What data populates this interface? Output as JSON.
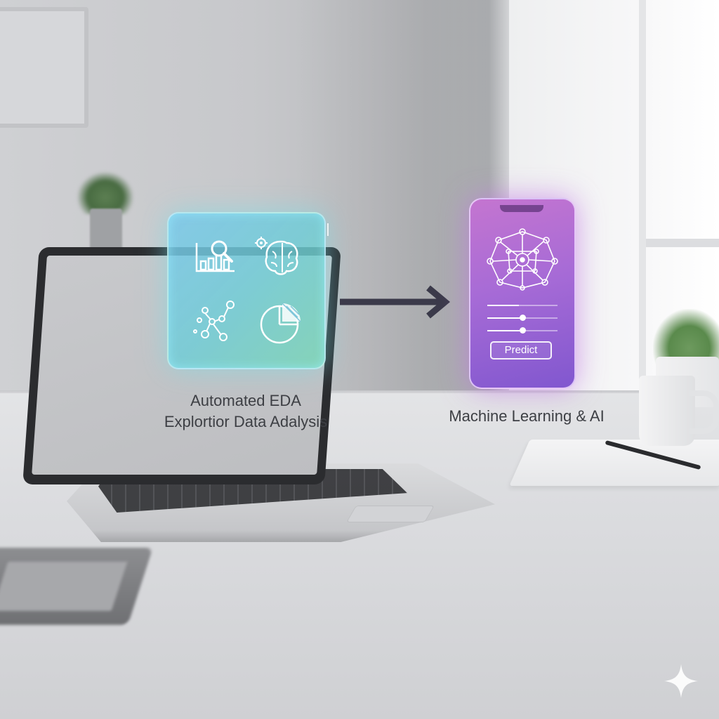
{
  "eda": {
    "title": "Automated EDA",
    "subtitle": "Explortior Data Adalysis",
    "icons": [
      "bar-chart-magnifier-icon",
      "brain-gear-icon",
      "scatter-network-icon",
      "pie-chart-icon"
    ]
  },
  "ml": {
    "title": "Machine Learning & AI",
    "predict_label": "Predict",
    "slider_levels": [
      0.45,
      0.5,
      0.5
    ],
    "icons": [
      "neural-network-icon"
    ]
  },
  "colors": {
    "eda_panel": "#7fd0e0",
    "phone_gradient_top": "#c475d0",
    "phone_gradient_bottom": "#8157cf",
    "arrow": "#3b3a4a",
    "caption_text": "#3d3f44"
  }
}
